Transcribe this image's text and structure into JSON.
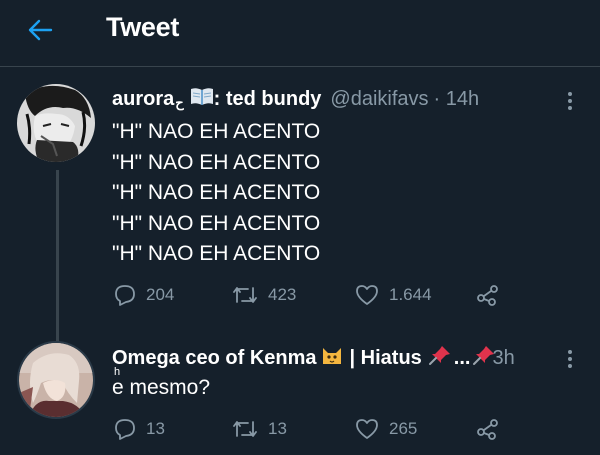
{
  "header": {
    "title": "Tweet"
  },
  "tweet": {
    "name": "aurora",
    "name_suffix": ": ted bundy",
    "handle": "@daikifavs",
    "time": "· 14h",
    "lines": [
      "\"H\" NAO EH ACENTO",
      "\"H\" NAO EH ACENTO",
      "\"H\" NAO EH ACENTO",
      "\"H\" NAO EH ACENTO",
      "\"H\" NAO EH ACENTO"
    ],
    "replies": "204",
    "retweets": "423",
    "likes": "1.644"
  },
  "reply": {
    "name": "Omega ceo of Kenma",
    "name_suffix": "| Hiatus",
    "ellipsis": "...",
    "time": "3h",
    "h_mark": "h",
    "text": "e mesmo?",
    "replies": "13",
    "retweets": "13",
    "likes": "265"
  },
  "icons": {
    "back": "arrow-left-icon",
    "more": "more-vertical-icon",
    "reply": "comment-icon",
    "retweet": "retweet-icon",
    "like": "heart-icon",
    "share": "share-icon",
    "book": "book-emoji-icon",
    "cat": "cat-emoji-icon",
    "pin": "pushpin-emoji-icon"
  },
  "colors": {
    "background": "#15202b",
    "accent": "#1da1f2",
    "muted": "#8899a6",
    "divider": "#38444d"
  }
}
